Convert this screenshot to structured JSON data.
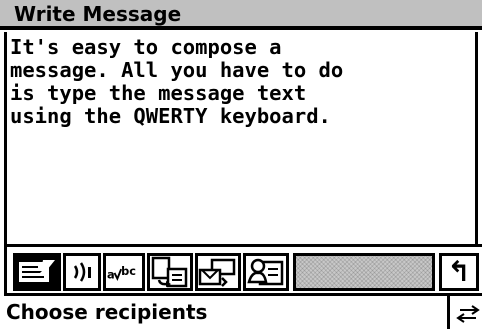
{
  "window": {
    "title": "Write Message"
  },
  "message": {
    "body": "It's easy to compose a\nmessage. All you have to do\nis type the message text\nusing the QWERTY keyboard."
  },
  "toolbar": {
    "tools": [
      {
        "icon": "compose-icon",
        "selected": true
      },
      {
        "icon": "sound-icon",
        "label": "))"
      },
      {
        "icon": "spellcheck-icon",
        "label": "a¥bc"
      },
      {
        "icon": "copy-paste-icon"
      },
      {
        "icon": "insert-template-icon"
      },
      {
        "icon": "contacts-icon"
      }
    ],
    "back_icon": "back-arrow-icon",
    "back_glyph": "↰"
  },
  "status": {
    "text": "Choose recipients",
    "scroll_icon": "scroll-arrows-icon",
    "scroll_glyph": "⇄"
  },
  "colors": {
    "titlebar": "#c0c0c0",
    "ink": "#000000",
    "paper": "#ffffff"
  }
}
